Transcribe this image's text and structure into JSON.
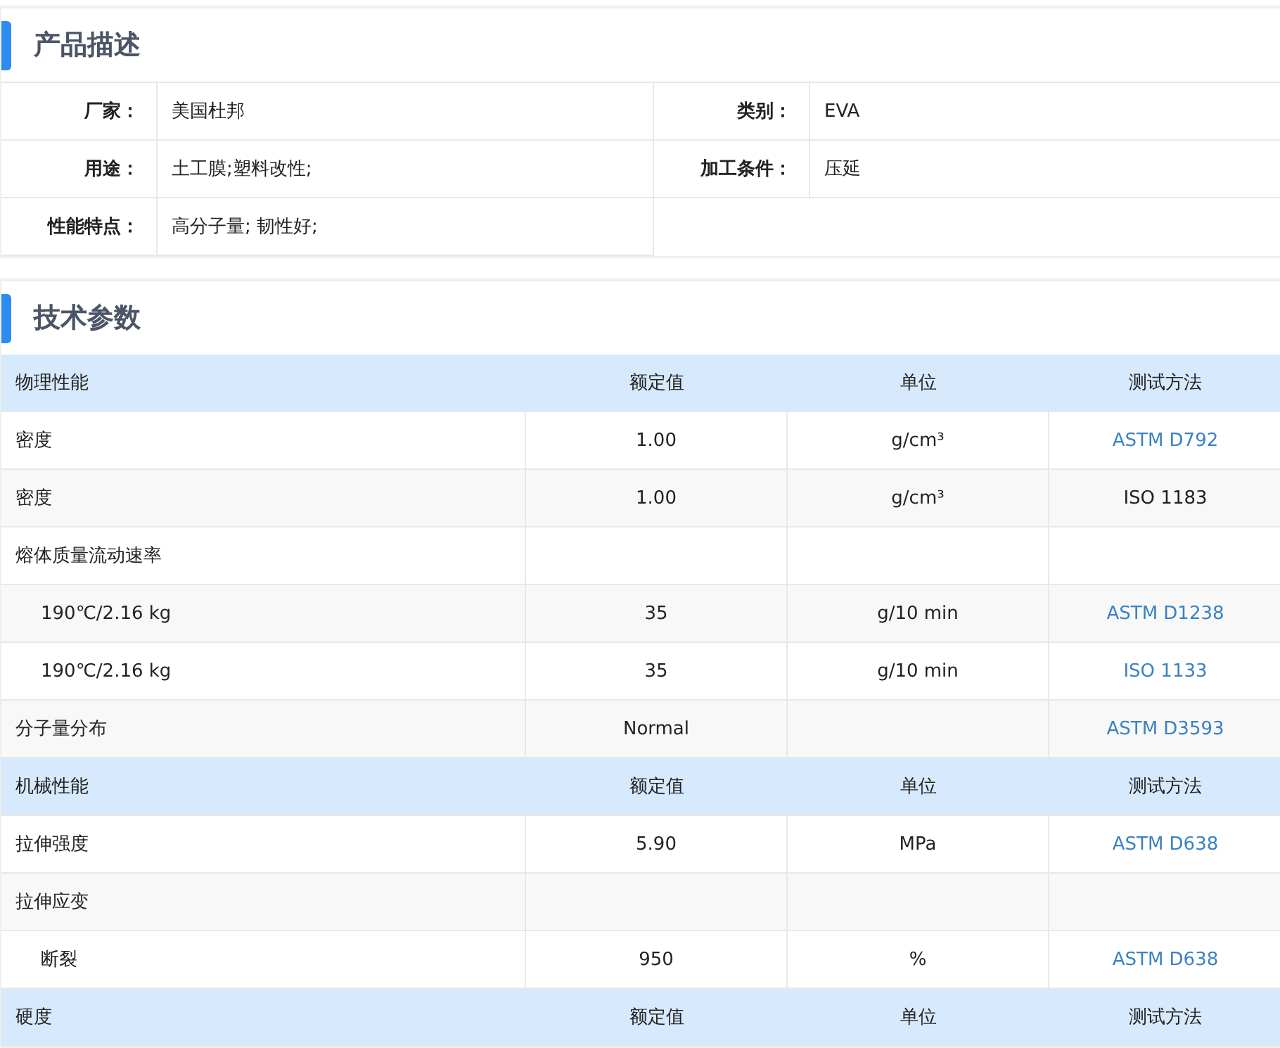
{
  "description": {
    "title": "产品描述",
    "fields": [
      {
        "label": "厂家：",
        "value": "美国杜邦"
      },
      {
        "label": "类别：",
        "value": "EVA"
      },
      {
        "label": "用途：",
        "value": "土工膜;塑料改性;"
      },
      {
        "label": "加工条件：",
        "value": "压延"
      },
      {
        "label": "性能特点：",
        "value": "高分子量; 韧性好;"
      }
    ]
  },
  "parameters": {
    "title": "技术参数",
    "rows": [
      {
        "kind": "header",
        "cells": [
          "物理性能",
          "额定值",
          "单位",
          "测试方法"
        ]
      },
      {
        "kind": "row",
        "indented": false,
        "cells": [
          "密度",
          "1.00",
          "g/cm³",
          "ASTM D792"
        ],
        "link": true
      },
      {
        "kind": "row",
        "indented": false,
        "cells": [
          "密度",
          "1.00",
          "g/cm³",
          "ISO 1183"
        ],
        "link": false
      },
      {
        "kind": "row",
        "indented": false,
        "cells": [
          "熔体质量流动速率",
          "",
          "",
          ""
        ]
      },
      {
        "kind": "row",
        "indented": true,
        "cells": [
          "190℃/2.16 kg",
          "35",
          "g/10 min",
          "ASTM D1238"
        ],
        "link": true
      },
      {
        "kind": "row",
        "indented": true,
        "cells": [
          "190℃/2.16 kg",
          "35",
          "g/10 min",
          "ISO 1133"
        ],
        "link": true
      },
      {
        "kind": "row",
        "indented": false,
        "cells": [
          "分子量分布",
          "Normal",
          "",
          "ASTM D3593"
        ],
        "link": true
      },
      {
        "kind": "header",
        "cells": [
          "机械性能",
          "额定值",
          "单位",
          "测试方法"
        ]
      },
      {
        "kind": "row",
        "indented": false,
        "cells": [
          "拉伸强度",
          "5.90",
          "MPa",
          "ASTM D638"
        ],
        "link": true
      },
      {
        "kind": "row",
        "indented": false,
        "cells": [
          "拉伸应变",
          "",
          "",
          ""
        ]
      },
      {
        "kind": "row",
        "indented": true,
        "cells": [
          "断裂",
          "950",
          "%",
          "ASTM D638"
        ],
        "link": true
      },
      {
        "kind": "header",
        "cells": [
          "硬度",
          "额定值",
          "单位",
          "测试方法"
        ]
      }
    ]
  }
}
